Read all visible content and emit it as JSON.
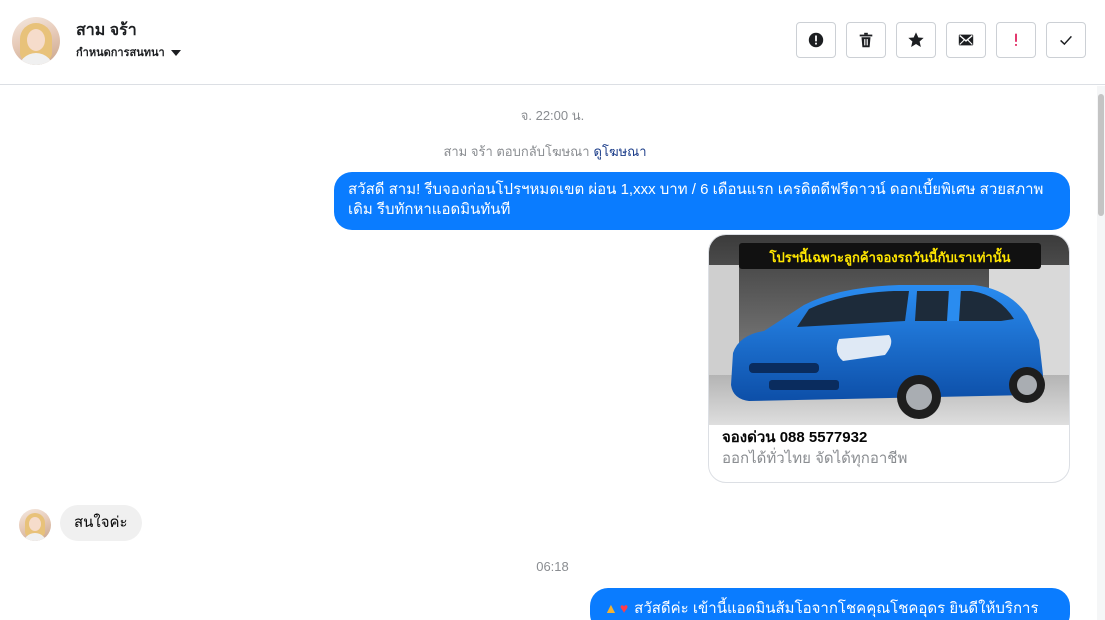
{
  "header": {
    "name": "สาม จร้า",
    "subtitle": "กำหนดการสนทนา"
  },
  "toolbar": [
    {
      "icon": "alert-circle-icon"
    },
    {
      "icon": "trash-icon"
    },
    {
      "icon": "star-icon"
    },
    {
      "icon": "envelope-icon"
    },
    {
      "icon": "exclamation-icon",
      "color": "#e0245e"
    },
    {
      "icon": "check-icon"
    }
  ],
  "thread": {
    "timestamp1": "จ. 22:00 น.",
    "ad_reply_text": "สาม จร้า ตอบกลับโฆษณา",
    "ad_reply_link": "ดูโฆษณา",
    "outgoing1": "สวัสดี สาม! รีบจองก่อนโปรฯหมดเขต ผ่อน 1,xxx บาท / 6 เดือนแรก เครดิตดีฟรีดาวน์ ดอกเบี้ยพิเศษ สวยสภาพเดิม รีบทักหาแอดมินทันที",
    "card": {
      "banner": "โปรฯนี้เฉพาะลูกค้าจองรถวันนี้กับเราเท่านั้น",
      "title": "จองด่วน 088 5577932",
      "subtitle": "ออกได้ทั่วไทย จัดได้ทุกอาชีพ"
    },
    "incoming1": "สนใจค่ะ",
    "timestamp2": "06:18",
    "outgoing2": "สวัสดีค่ะ เข้านี้แอดมินส้มโอจากโชคคุณโชคอุดร ยินดีให้บริการค่ะ"
  },
  "colors": {
    "outgoing_bubble": "#0a7cff",
    "incoming_bubble": "#f0f0f0",
    "car_body": "#1a6fd1",
    "banner_text": "#ffe600"
  }
}
